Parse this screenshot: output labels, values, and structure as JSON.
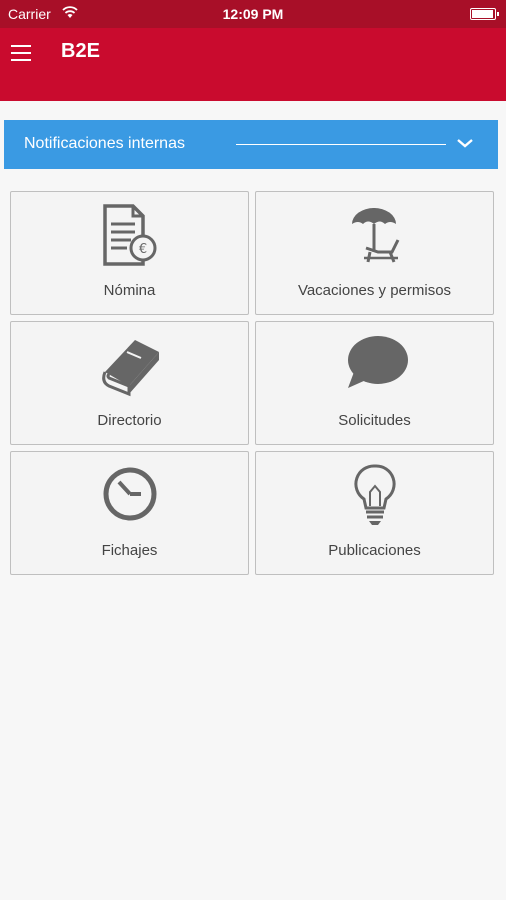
{
  "status_bar": {
    "carrier": "Carrier",
    "time": "12:09 PM",
    "wifi_icon": "wifi-icon",
    "battery_icon": "battery-icon"
  },
  "app_bar": {
    "title": "B2E",
    "menu_icon": "hamburger-menu-icon",
    "background_color": "#c90b2e"
  },
  "notifications": {
    "label": "Notificaciones internas",
    "chevron_icon": "chevron-down-icon",
    "background_color": "#3a9ae3"
  },
  "tiles": [
    {
      "label": "Nómina",
      "icon": "payslip-euro-icon"
    },
    {
      "label": "Vacaciones y permisos",
      "icon": "beach-umbrella-icon"
    },
    {
      "label": "Directorio",
      "icon": "book-icon"
    },
    {
      "label": "Solicitudes",
      "icon": "speech-bubble-icon"
    },
    {
      "label": "Fichajes",
      "icon": "clock-icon"
    },
    {
      "label": "Publicaciones",
      "icon": "lightbulb-icon"
    }
  ]
}
